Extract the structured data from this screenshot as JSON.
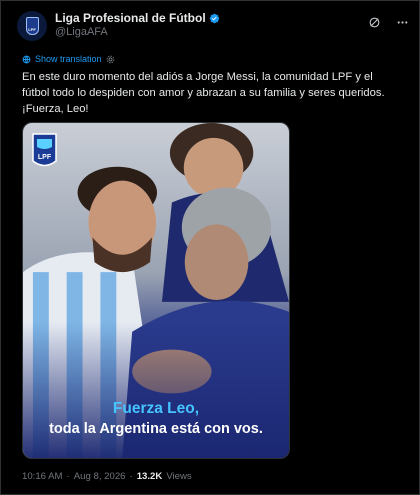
{
  "account": {
    "display_name": "Liga Profesional de Fútbol",
    "handle": "@LigaAFA",
    "avatar_text": "LPF"
  },
  "translation": {
    "label": "Show translation"
  },
  "tweet": {
    "line1": "En este duro momento del adiós a Jorge Messi, la comunidad LPF y el",
    "line2": "fútbol todo lo despiden con amor y abrazan a su familia y seres queridos.",
    "line3": "¡Fuerza, Leo!"
  },
  "media": {
    "logo_text": "LPF",
    "caption_line1": "Fuerza Leo,",
    "caption_line2": "toda la Argentina está con vos."
  },
  "meta": {
    "time": "10:16 AM",
    "separator1": "·",
    "date": "Aug 8, 2026",
    "separator2": "·",
    "views_count": "13.2K",
    "views_label": "Views"
  },
  "colors": {
    "background": "#000000",
    "text_primary": "#e7e9ea",
    "text_secondary": "#71767b",
    "accent_blue": "#1d9bf0",
    "caption_blue": "#46c4ff"
  },
  "icons": {
    "verified": "verified-badge-icon",
    "grok": "grok-icon",
    "more": "more-options-icon",
    "translate": "globe-icon",
    "settings": "gear-icon"
  }
}
